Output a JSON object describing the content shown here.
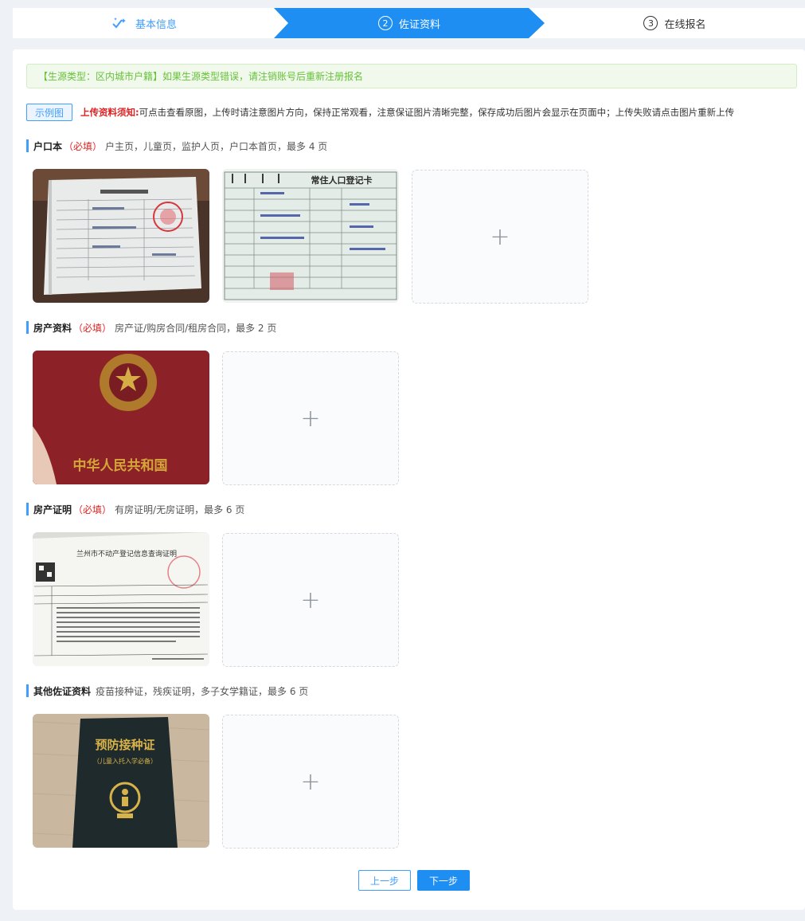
{
  "steps": [
    {
      "label": "基本信息",
      "num": ""
    },
    {
      "label": "佐证资料",
      "num": "2"
    },
    {
      "label": "在线报名",
      "num": "3"
    }
  ],
  "notice": "【生源类型：区内城市户籍】如果生源类型错误，请注销账号后重新注册报名",
  "tip": {
    "example_button": "示例图",
    "title": "上传资料须知:",
    "text": "可点击查看原图，上传时请注意图片方向，保持正常观看，注意保证图片清晰完整，保存成功后图片会显示在页面中；上传失败请点击图片重新上传"
  },
  "sections": [
    {
      "name": "户口本",
      "required": "（必填）",
      "desc": "户主页，儿童页，监护人页，户口本首页，最多 4 页"
    },
    {
      "name": "房产资料",
      "required": "（必填）",
      "desc": "房产证/购房合同/租房合同，最多 2 页"
    },
    {
      "name": "房产证明",
      "required": "（必填）",
      "desc": "有房证明/无房证明，最多 6 页"
    },
    {
      "name": "其他佐证资料",
      "required": "",
      "desc": "疫苗接种证，残疾证明，多子女学籍证，最多 6 页"
    }
  ],
  "images": {
    "hukou2_title": "常住人口登记卡",
    "house_cover_text": "中华人民共和国",
    "proof_title": "兰州市不动产登记信息查询证明",
    "vaccine_title": "预防接种证",
    "vaccine_subtitle": "（儿童入托入学必备）"
  },
  "upload_plus": "+",
  "buttons": {
    "prev": "上一步",
    "next": "下一步"
  },
  "colors": {
    "primary": "#1e8ef3",
    "required": "#e02020",
    "success": "#67c23a"
  }
}
